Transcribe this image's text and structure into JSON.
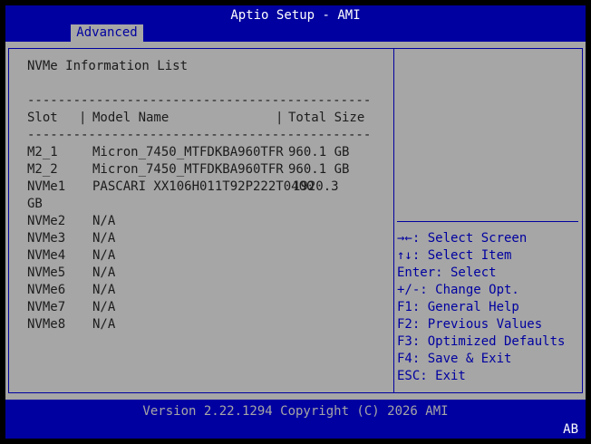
{
  "header": {
    "title": "Aptio Setup - AMI",
    "tab_label": "Advanced"
  },
  "main": {
    "heading": "NVMe Information List",
    "separator": "---------------------------------------------",
    "columns": {
      "slot": "Slot",
      "model": "Model Name",
      "size": "Total Size"
    },
    "column_divider": "|",
    "rows": [
      {
        "slot": "M2_1",
        "model": "Micron_7450_MTFDKBA960TFR",
        "size": "960.1 GB"
      },
      {
        "slot": "M2_2",
        "model": "Micron_7450_MTFDKBA960TFR",
        "size": "960.1 GB"
      },
      {
        "slot": "NVMe1",
        "model": "PASCARI XX106H011T92P222T0400",
        "size": "1920.3"
      },
      {
        "slot": "GB",
        "model": "",
        "size": ""
      },
      {
        "slot": "NVMe2",
        "model": "N/A",
        "size": ""
      },
      {
        "slot": "NVMe3",
        "model": "N/A",
        "size": ""
      },
      {
        "slot": "NVMe4",
        "model": "N/A",
        "size": ""
      },
      {
        "slot": "NVMe5",
        "model": "N/A",
        "size": ""
      },
      {
        "slot": "NVMe6",
        "model": "N/A",
        "size": ""
      },
      {
        "slot": "NVMe7",
        "model": "N/A",
        "size": ""
      },
      {
        "slot": "NVMe8",
        "model": "N/A",
        "size": ""
      }
    ]
  },
  "help": {
    "items": [
      "→←: Select Screen",
      "↑↓: Select Item",
      "Enter: Select",
      "+/-: Change Opt.",
      "F1: General Help",
      "F2: Previous Values",
      "F3: Optimized Defaults",
      "F4: Save & Exit",
      "ESC: Exit"
    ]
  },
  "footer": {
    "version": "Version 2.22.1294 Copyright (C) 2026 AMI",
    "badge": "AB"
  },
  "colors": {
    "bios_blue": "#0000a0",
    "panel_grey": "#a6a6a6",
    "text_dark": "#1c1c1c",
    "white": "#ffffff"
  }
}
